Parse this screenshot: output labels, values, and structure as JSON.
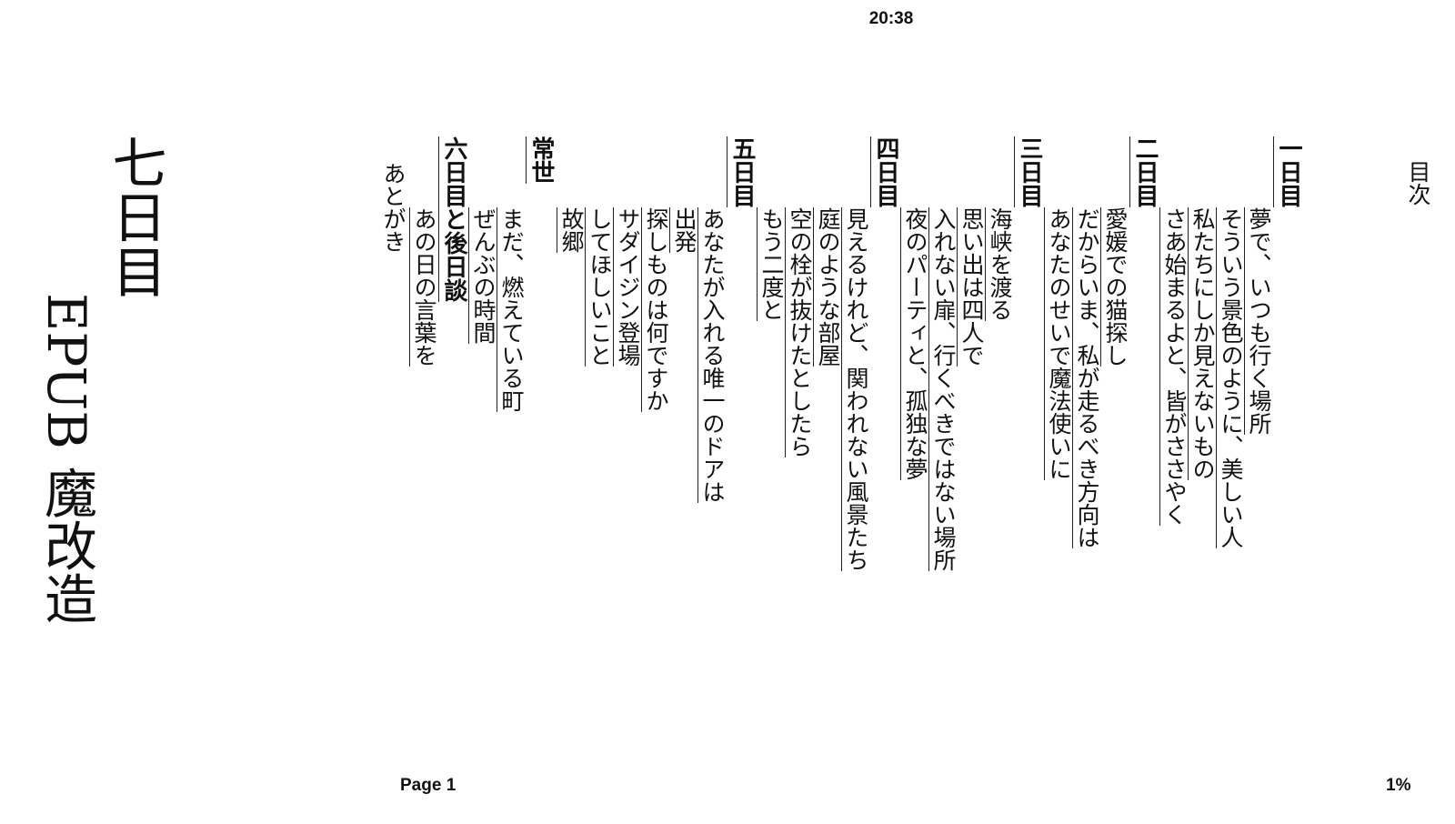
{
  "status": {
    "time": "20:38"
  },
  "footer": {
    "page": "Page 1",
    "progress": "1%"
  },
  "book": {
    "title": "七日目",
    "subtitle": "EPUB 魔改造"
  },
  "toc": {
    "heading": "目次",
    "chapters": [
      {
        "title": "一日目",
        "items": [
          "夢で、いつも行く場所",
          "そういう景色のように、美しい人",
          "私たちにしか見えないもの",
          "さあ始まるよと、皆がささやく"
        ]
      },
      {
        "title": "二日目",
        "items": [
          "愛媛での猫探し",
          "だからいま、私が走るべき方向は",
          "あなたのせいで魔法使いに"
        ]
      },
      {
        "title": "三日目",
        "items": [
          "海峡を渡る",
          "思い出は四人で",
          "入れない扉、行くべきではない場所",
          "夜のパーティと、孤独な夢"
        ]
      },
      {
        "title": "四日目",
        "items": [
          "見えるけれど、関われない風景たち",
          "庭のような部屋",
          "空の栓が抜けたとしたら",
          "もう二度と"
        ]
      },
      {
        "title": "五日目",
        "items": [
          "あなたが入れる唯一のドアは",
          "出発",
          "探しものは何ですか",
          "サダイジン登場",
          "してほしいこと",
          "故郷"
        ]
      },
      {
        "title": "常世",
        "items": [
          "まだ、燃えている町",
          "ぜんぶの時間"
        ]
      },
      {
        "title": "六日目と後日談",
        "items": [
          "あの日の言葉を"
        ]
      }
    ],
    "afterword": "あとがき"
  }
}
